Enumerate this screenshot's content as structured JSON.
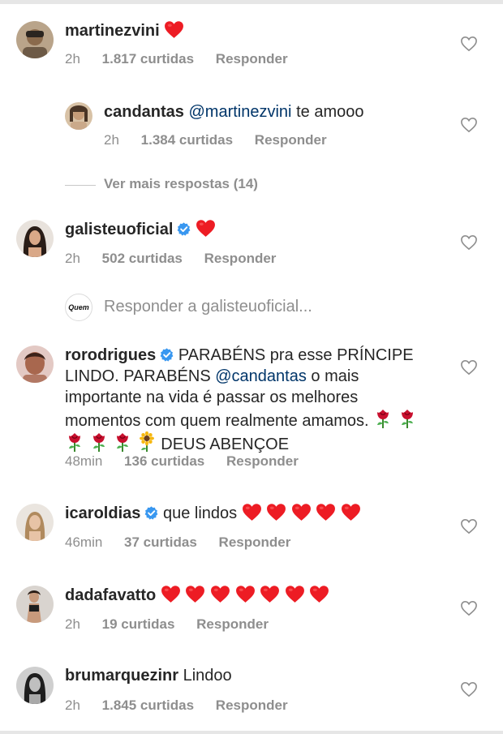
{
  "comments": [
    {
      "username": "martinezvini",
      "text": "",
      "time": "2h",
      "likes": "1.817 curtidas",
      "reply": "Responder"
    },
    {
      "username": "candantas",
      "mention": "@martinezvini",
      "text": "te amooo",
      "time": "2h",
      "likes": "1.384 curtidas",
      "reply": "Responder"
    },
    {
      "username": "galisteuoficial",
      "text": "",
      "time": "2h",
      "likes": "502 curtidas",
      "reply": "Responder"
    },
    {
      "username": "rorodrigues",
      "text_a": "PARABÉNS pra esse PRÍNCIPE LINDO. PARABÉNS",
      "mention": "@candantas",
      "text_b": "o mais importante na vida é passar os melhores momentos com quem realmente amamos.",
      "text_c": "DEUS ABENÇOE",
      "time": "48min",
      "likes": "136 curtidas",
      "reply": "Responder"
    },
    {
      "username": "icaroldias",
      "text": "que lindos",
      "time": "46min",
      "likes": "37 curtidas",
      "reply": "Responder"
    },
    {
      "username": "dadafavatto",
      "text": "",
      "time": "2h",
      "likes": "19 curtidas",
      "reply": "Responder"
    },
    {
      "username": "brumarquezinr",
      "text": "Lindoo",
      "time": "2h",
      "likes": "1.845 curtidas",
      "reply": "Responder"
    }
  ],
  "more_replies": "Ver mais respostas (14)",
  "reply_input": {
    "avatar_text": "Quem",
    "placeholder": "Responder a galisteuoficial..."
  },
  "icons": {
    "like": "heart-outline-icon",
    "emoji_heart": "red-heart-emoji",
    "rose": "rose-emoji",
    "sunflower": "sunflower-emoji",
    "verified": "verified-badge-icon"
  },
  "colors": {
    "text": "#262626",
    "meta": "#8e8e8e",
    "mention": "#003569",
    "heart": "#ed4956",
    "verified": "#3897f0"
  }
}
